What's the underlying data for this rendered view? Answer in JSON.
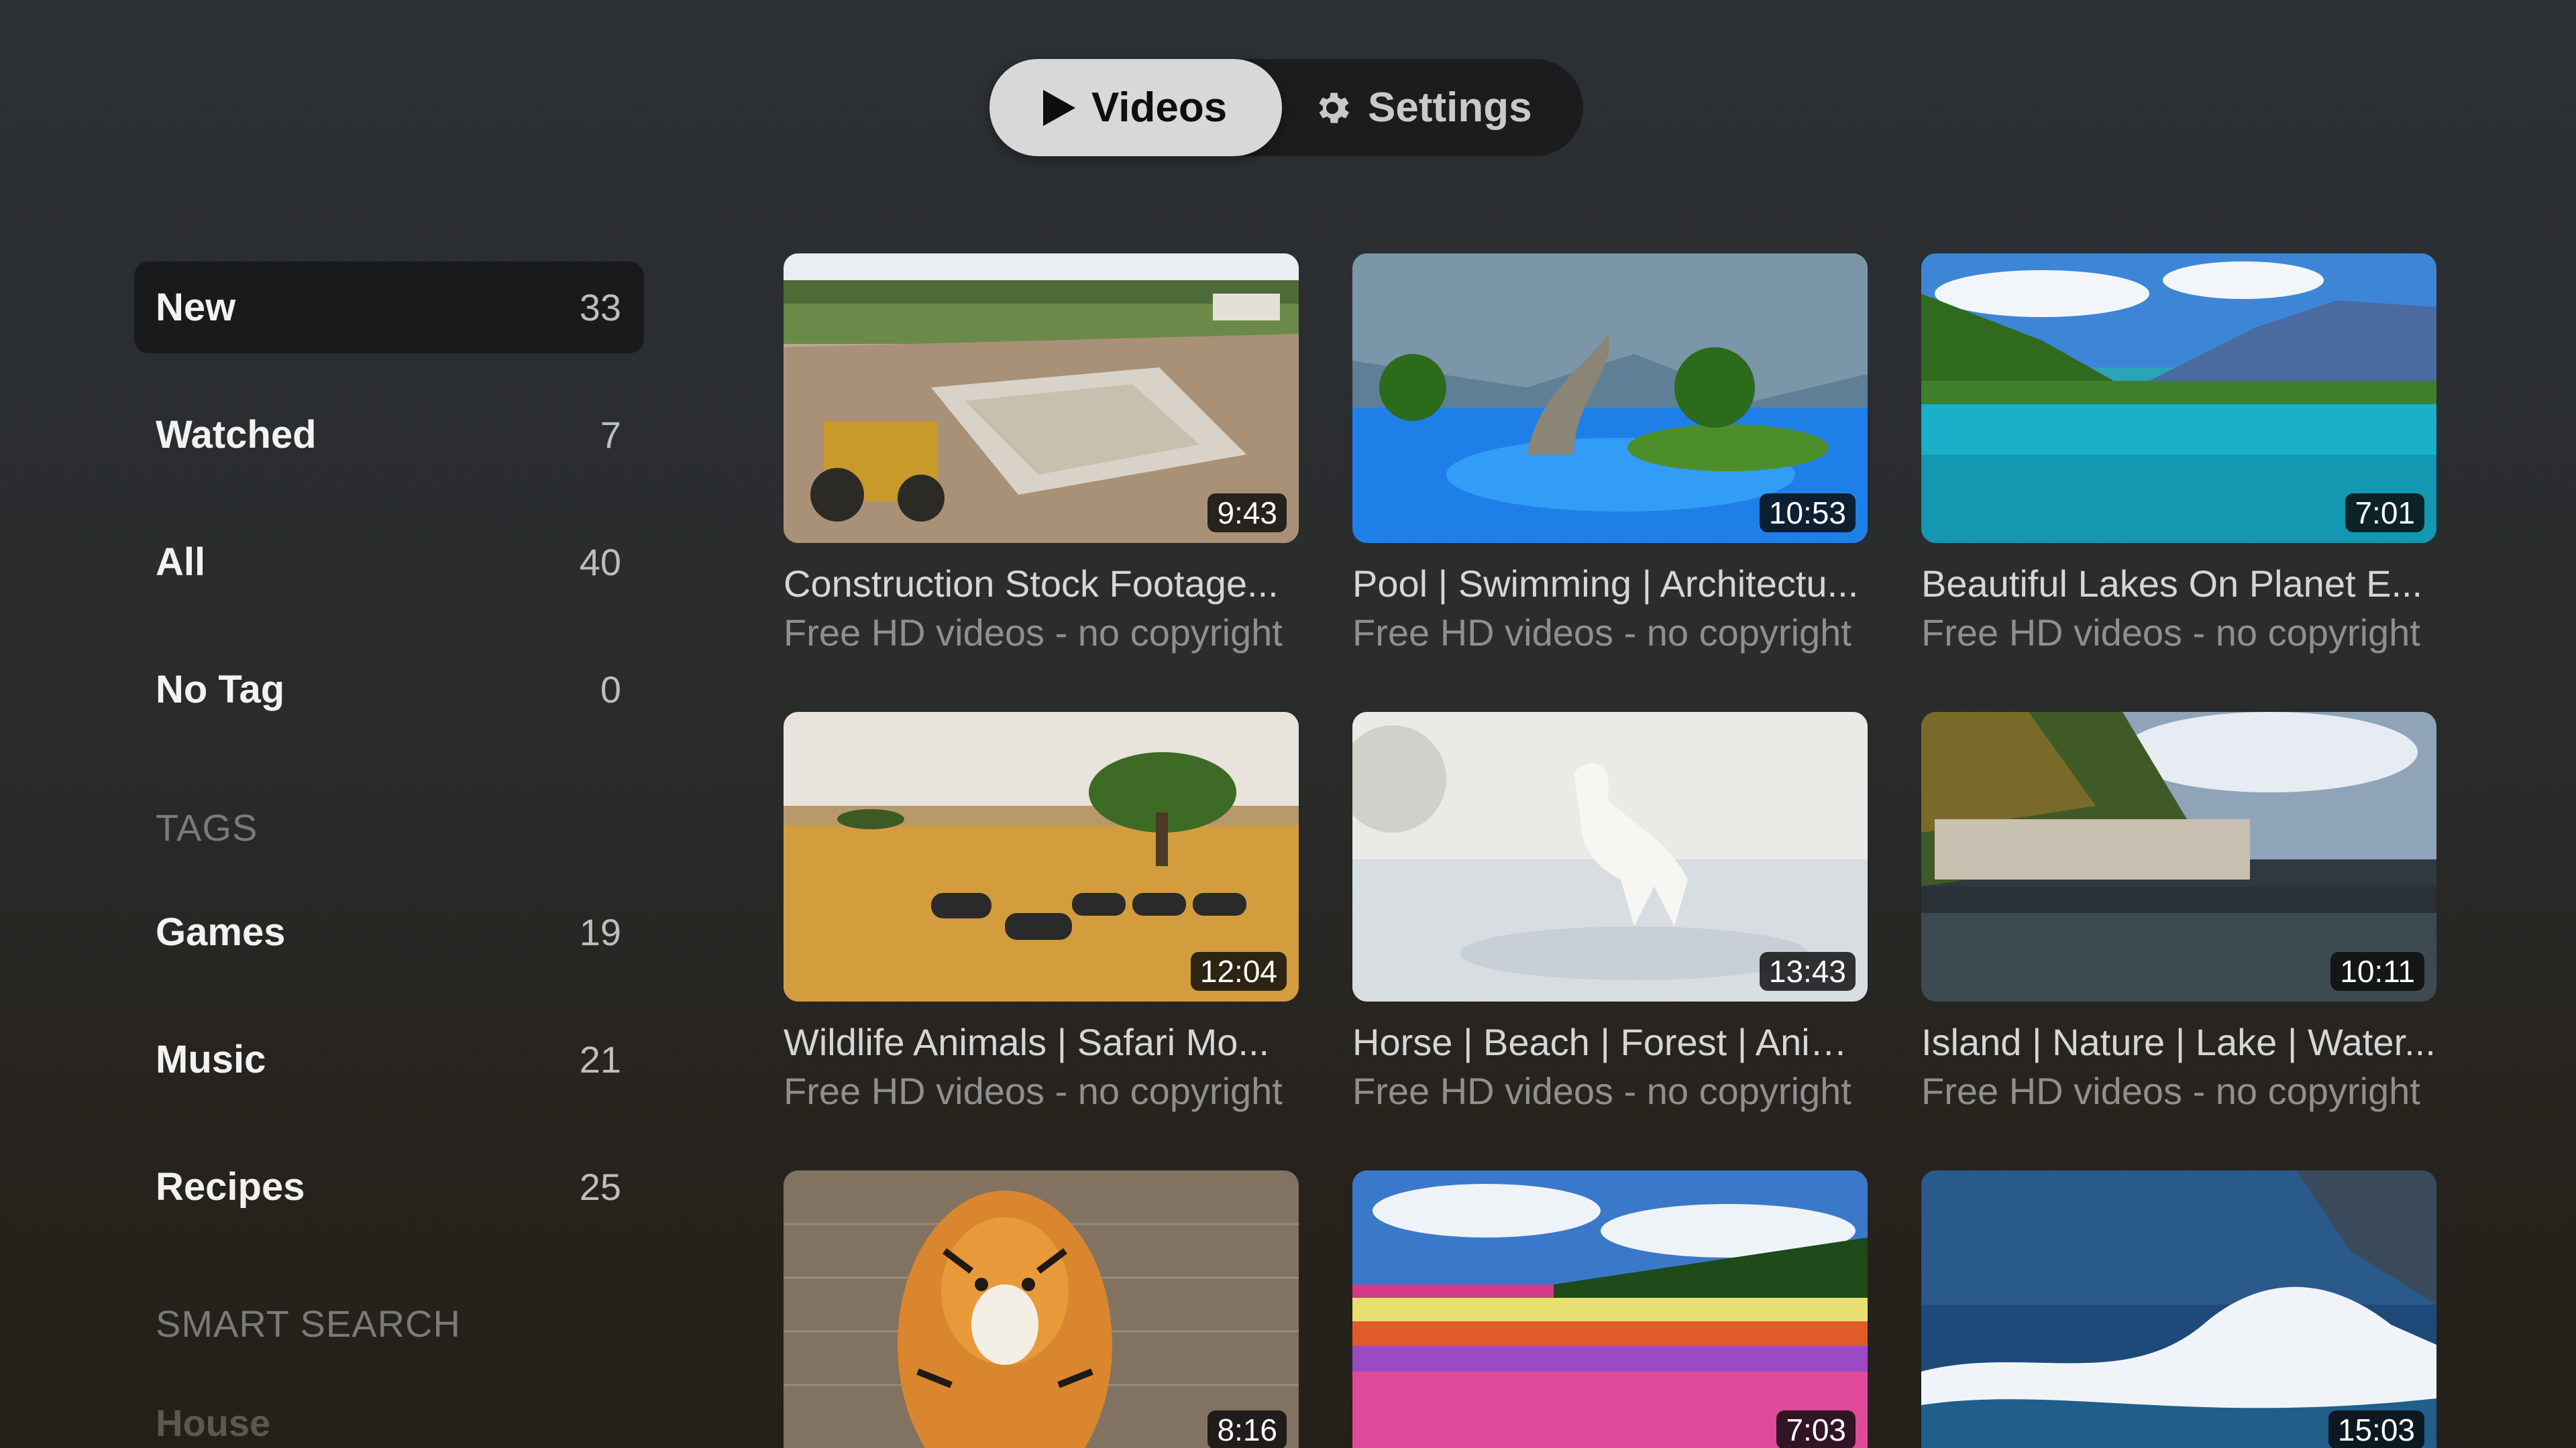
{
  "tabs": {
    "videos_label": "Videos",
    "settings_label": "Settings"
  },
  "sidebar": {
    "items": [
      {
        "label": "New",
        "count": "33"
      },
      {
        "label": "Watched",
        "count": "7"
      },
      {
        "label": "All",
        "count": "40"
      },
      {
        "label": "No Tag",
        "count": "0"
      }
    ],
    "tags_heading": "TAGS",
    "tags": [
      {
        "label": "Games",
        "count": "19"
      },
      {
        "label": "Music",
        "count": "21"
      },
      {
        "label": "Recipes",
        "count": "25"
      }
    ],
    "smart_search_heading": "SMART SEARCH",
    "smart_search_items": [
      {
        "label": "House"
      }
    ]
  },
  "videos": [
    {
      "title": "Construction Stock Footage...",
      "subtitle": "Free HD videos - no copyright",
      "duration": "9:43",
      "thumb_icon": "construction-site-thumbnail"
    },
    {
      "title": "Pool | Swimming | Architectu...",
      "subtitle": "Free HD videos - no copyright",
      "duration": "10:53",
      "thumb_icon": "pool-thumbnail"
    },
    {
      "title": "Beautiful Lakes On Planet E...",
      "subtitle": "Free HD videos - no copyright",
      "duration": "7:01",
      "thumb_icon": "lake-thumbnail"
    },
    {
      "title": "Wildlife Animals | Safari Mo...",
      "subtitle": "Free HD videos - no copyright",
      "duration": "12:04",
      "thumb_icon": "safari-zebras-thumbnail"
    },
    {
      "title": "Horse | Beach | Forest | Anim...",
      "subtitle": "Free HD videos - no copyright",
      "duration": "13:43",
      "thumb_icon": "white-horse-thumbnail"
    },
    {
      "title": "Island | Nature | Lake | Water...",
      "subtitle": "Free HD videos - no copyright",
      "duration": "10:11",
      "thumb_icon": "island-village-thumbnail"
    },
    {
      "title": "",
      "subtitle": "",
      "duration": "8:16",
      "thumb_icon": "tiger-thumbnail"
    },
    {
      "title": "",
      "subtitle": "",
      "duration": "7:03",
      "thumb_icon": "flower-field-thumbnail"
    },
    {
      "title": "",
      "subtitle": "",
      "duration": "15:03",
      "thumb_icon": "ocean-wave-thumbnail"
    }
  ],
  "colors": {
    "segment_active_bg": "#d8d8d8",
    "segment_bar_bg": "#1b1c1e",
    "sidebar_active_bg": "#191a1c",
    "title_text": "#d6d6d6",
    "subtitle_text": "#8f8f8f"
  }
}
